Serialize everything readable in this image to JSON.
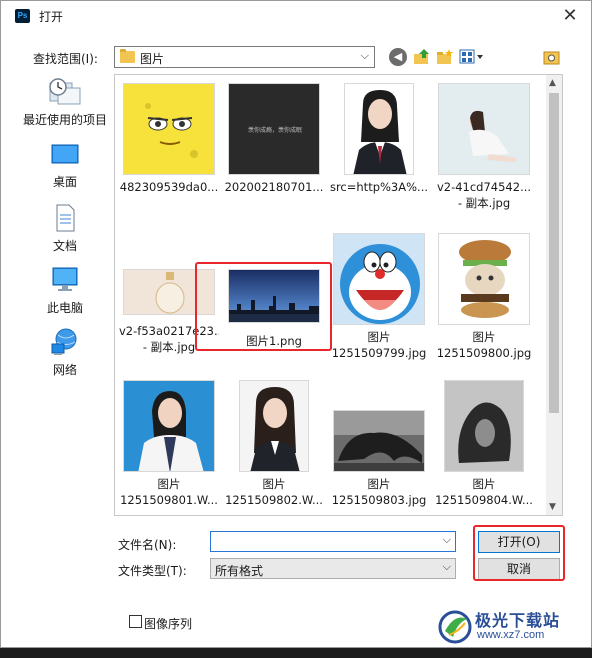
{
  "window": {
    "title": "打开",
    "app_icon": "Ps"
  },
  "lookin": {
    "label": "查找范围(I):",
    "value": "图片"
  },
  "places": [
    {
      "label": "最近使用的项目",
      "icon": "recent-icon"
    },
    {
      "label": "桌面",
      "icon": "desktop-icon"
    },
    {
      "label": "文档",
      "icon": "documents-icon"
    },
    {
      "label": "此电脑",
      "icon": "this-pc-icon"
    },
    {
      "label": "网络",
      "icon": "network-icon"
    }
  ],
  "files": [
    {
      "line1": "482309539da0...",
      "line2": ""
    },
    {
      "line1": "202002180701...",
      "line2": ""
    },
    {
      "line1": "src=http%3A%...",
      "line2": ""
    },
    {
      "line1": "v2-41cd74542...",
      "line2": "- 副本.jpg"
    },
    {
      "line1": "v2-f53a0217e23...",
      "line2": "- 副本.jpg"
    },
    {
      "line1": "图片1.png",
      "line2": ""
    },
    {
      "line1": "图片",
      "line2": "1251509799.jpg"
    },
    {
      "line1": "图片",
      "line2": "1251509800.jpg"
    },
    {
      "line1": "图片",
      "line2": "1251509801.W..."
    },
    {
      "line1": "图片",
      "line2": "1251509802.W..."
    },
    {
      "line1": "图片",
      "line2": "1251509803.jpg"
    },
    {
      "line1": "图片",
      "line2": "1251509804.W..."
    }
  ],
  "thumb_overlay_text": "羡你成瘾，羡你成眠",
  "filename": {
    "label": "文件名(N):",
    "value": ""
  },
  "filetype": {
    "label": "文件类型(T):",
    "value": "所有格式"
  },
  "buttons": {
    "open": "打开(O)",
    "cancel": "取消"
  },
  "sequence": {
    "label": "图像序列",
    "checked": false
  },
  "watermark": {
    "text": "极光下载站",
    "url": "www.xz7.com"
  },
  "colors": {
    "highlight": "#e8262b",
    "accent": "#0078d7",
    "watermark": "#2a4f97"
  }
}
